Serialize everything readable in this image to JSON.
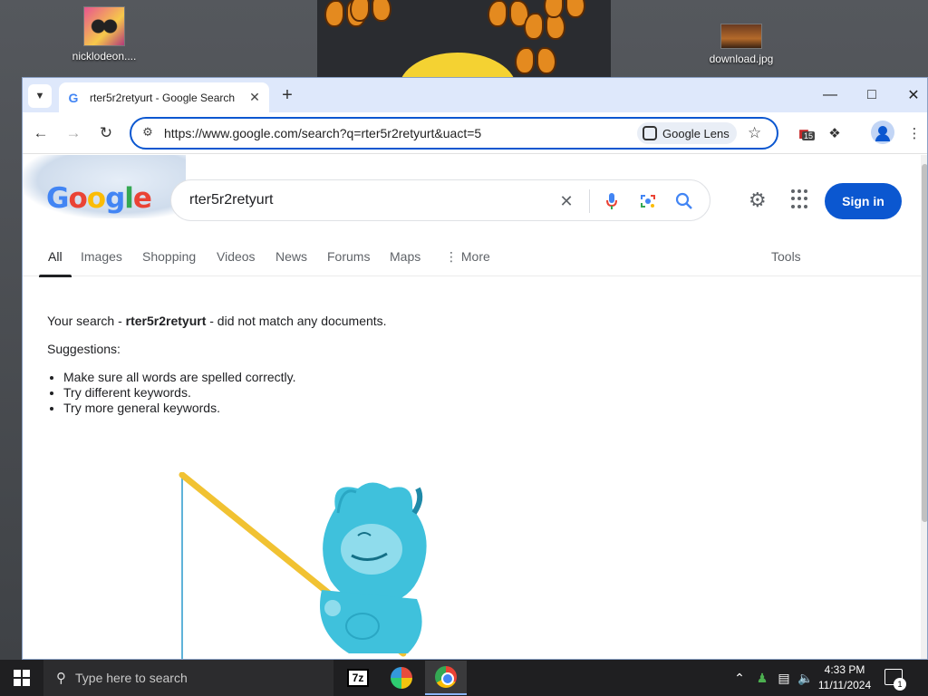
{
  "desktop": {
    "icons": [
      {
        "label": "nicklodeon...."
      },
      {
        "label": "download.jpg"
      }
    ]
  },
  "browser": {
    "tab": {
      "title": "rter5r2retyurt - Google Search",
      "favicon": "G"
    },
    "new_tab_label": "+",
    "window_controls": {
      "minimize": "—",
      "maximize": "□",
      "close": "✕"
    },
    "address": {
      "url": "https://www.google.com/search?q=rter5r2retyurt&uact=5"
    },
    "lens_chip": "Google Lens",
    "extension_badge": "15"
  },
  "google": {
    "logo": {
      "letters": [
        "G",
        "o",
        "o",
        "g",
        "l",
        "e"
      ],
      "colors": [
        "#4285f4",
        "#ea4335",
        "#fbbc05",
        "#4285f4",
        "#34a853",
        "#ea4335"
      ]
    },
    "query": "rter5r2retyurt",
    "signin": "Sign in",
    "tabs": [
      {
        "label": "All",
        "active": true
      },
      {
        "label": "Images"
      },
      {
        "label": "Shopping"
      },
      {
        "label": "Videos"
      },
      {
        "label": "News"
      },
      {
        "label": "Forums"
      },
      {
        "label": "Maps"
      },
      {
        "label": "More"
      }
    ],
    "tools": "Tools",
    "message": {
      "prefix": "Your search - ",
      "term": "rter5r2retyurt",
      "suffix": " - did not match any documents."
    },
    "suggestions_heading": "Suggestions:",
    "suggestions": [
      "Make sure all words are spelled correctly.",
      "Try different keywords.",
      "Try more general keywords."
    ]
  },
  "taskbar": {
    "search_placeholder": "Type here to search",
    "apps": [
      "7-Zip",
      "Paint",
      "Google Chrome"
    ],
    "sevenzip_label": "7z",
    "time": "4:33 PM",
    "date": "11/11/2024",
    "notification_count": "1"
  },
  "colors": {
    "accent": "#0b57d0",
    "tabstrip": "#dee8fb",
    "taskbar": "#1f1f21"
  }
}
